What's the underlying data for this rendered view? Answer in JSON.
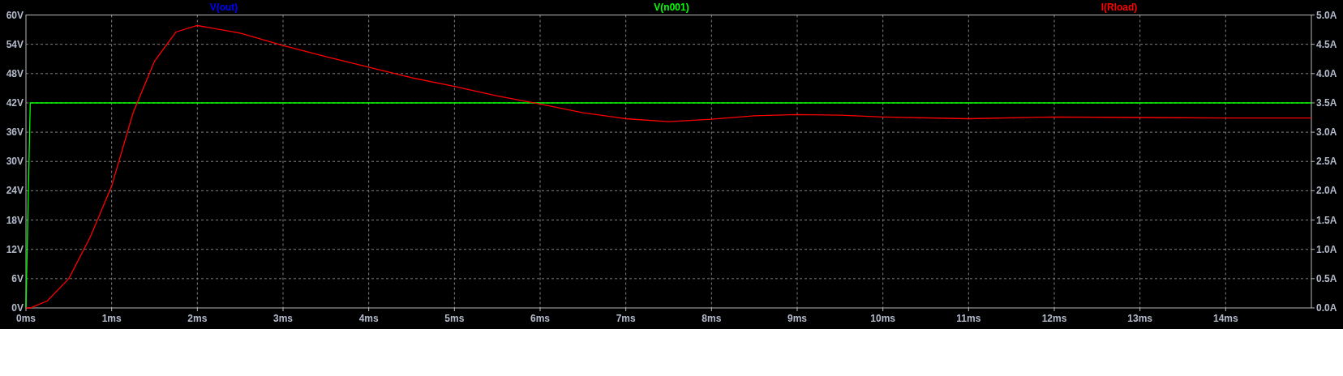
{
  "plot": {
    "chart_data": {
      "type": "line",
      "grid": true,
      "x": [
        0,
        0.05,
        0.25,
        0.5,
        0.75,
        1,
        1.25,
        1.5,
        1.75,
        2,
        2.5,
        3,
        3.5,
        4,
        4.5,
        5,
        5.5,
        6,
        6.5,
        7,
        7.5,
        8,
        8.5,
        9,
        9.5,
        10,
        11,
        12,
        13,
        14,
        15
      ],
      "series": [
        {
          "name": "V(out)",
          "color": "#0000ff",
          "values": [
            null,
            null,
            null,
            null,
            null,
            null,
            null,
            null,
            null,
            null,
            null,
            null,
            null,
            null,
            null,
            null,
            null,
            null,
            null,
            null,
            null,
            null,
            null,
            null,
            null,
            null,
            null,
            null,
            null,
            null,
            null
          ]
        },
        {
          "name": "V(n001)",
          "color": "#00ff00",
          "values": [
            0,
            42,
            42,
            42,
            42,
            42,
            42,
            42,
            42,
            42,
            42,
            42,
            42,
            42,
            42,
            42,
            42,
            42,
            42,
            42,
            42,
            42,
            42,
            42,
            42,
            42,
            42,
            42,
            42,
            42,
            42
          ]
        },
        {
          "name": "I(Rload)",
          "color": "#ff0000",
          "axis": "y2",
          "values": [
            0,
            0,
            0.12,
            0.5,
            1.21,
            2.08,
            3.33,
            4.21,
            4.71,
            4.82,
            4.69,
            4.48,
            4.29,
            4.11,
            3.93,
            3.78,
            3.62,
            3.48,
            3.33,
            3.23,
            3.18,
            3.22,
            3.28,
            3.3,
            3.29,
            3.26,
            3.23,
            3.26,
            3.25,
            3.24,
            3.24
          ]
        }
      ],
      "xlim": [
        0,
        15
      ],
      "ylim": [
        0,
        60
      ],
      "y2lim": [
        0,
        5
      ],
      "xticks": [
        {
          "value": 0,
          "label": "0ms"
        },
        {
          "value": 1,
          "label": "1ms"
        },
        {
          "value": 2,
          "label": "2ms"
        },
        {
          "value": 3,
          "label": "3ms"
        },
        {
          "value": 4,
          "label": "4ms"
        },
        {
          "value": 5,
          "label": "5ms"
        },
        {
          "value": 6,
          "label": "6ms"
        },
        {
          "value": 7,
          "label": "7ms"
        },
        {
          "value": 8,
          "label": "8ms"
        },
        {
          "value": 9,
          "label": "9ms"
        },
        {
          "value": 10,
          "label": "10ms"
        },
        {
          "value": 11,
          "label": "11ms"
        },
        {
          "value": 12,
          "label": "12ms"
        },
        {
          "value": 13,
          "label": "13ms"
        },
        {
          "value": 14,
          "label": "14ms"
        }
      ],
      "yticks": [
        {
          "value": 0,
          "label": "0V"
        },
        {
          "value": 6,
          "label": "6V"
        },
        {
          "value": 12,
          "label": "12V"
        },
        {
          "value": 18,
          "label": "18V"
        },
        {
          "value": 24,
          "label": "24V"
        },
        {
          "value": 30,
          "label": "30V"
        },
        {
          "value": 36,
          "label": "36V"
        },
        {
          "value": 42,
          "label": "42V"
        },
        {
          "value": 48,
          "label": "48V"
        },
        {
          "value": 54,
          "label": "54V"
        },
        {
          "value": 60,
          "label": "60V"
        }
      ],
      "y2ticks": [
        {
          "value": 0,
          "label": "0.0A"
        },
        {
          "value": 0.5,
          "label": "0.5A"
        },
        {
          "value": 1,
          "label": "1.0A"
        },
        {
          "value": 1.5,
          "label": "1.5A"
        },
        {
          "value": 2,
          "label": "2.0A"
        },
        {
          "value": 2.5,
          "label": "2.5A"
        },
        {
          "value": 3,
          "label": "3.0A"
        },
        {
          "value": 3.5,
          "label": "3.5A"
        },
        {
          "value": 4,
          "label": "4.0A"
        },
        {
          "value": 4.5,
          "label": "4.5A"
        },
        {
          "value": 5,
          "label": "5.0A"
        }
      ]
    }
  }
}
